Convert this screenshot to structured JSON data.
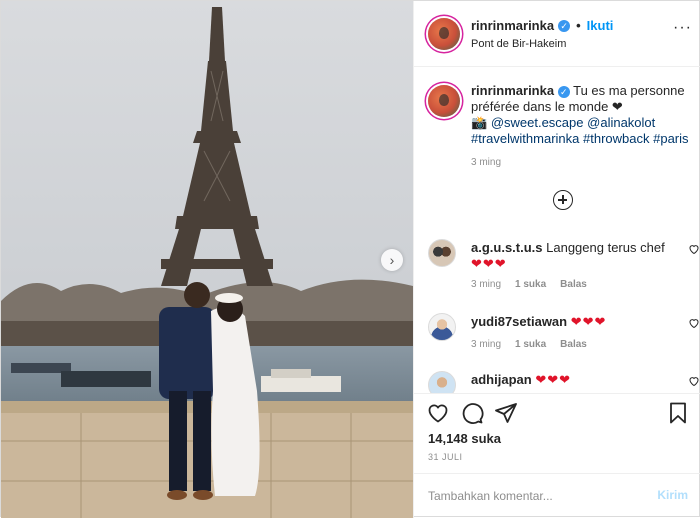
{
  "colors": {
    "accent": "#0095f6",
    "heart": "#e0142a",
    "border": "#dbdbdb",
    "muted": "#8e8e8e"
  },
  "post": {
    "username": "rinrinmarinka",
    "follow_label": "Ikuti",
    "location": "Pont de Bir-Hakeim",
    "caption": {
      "username": "rinrinmarinka",
      "text": "Tu es ma personne préférée dans le monde ❤",
      "camera_emoji": "📸",
      "mentions": [
        "@sweet.escape",
        "@alinakolot"
      ],
      "hashtags": [
        "#travelwithmarinka",
        "#throwback",
        "#paris"
      ],
      "time": "3 ming"
    },
    "comments": [
      {
        "username": "a.g.u.s.t.u.s",
        "text": "Langgeng terus chef",
        "hearts": "❤❤❤",
        "time": "3 ming",
        "likes": "1 suka",
        "reply": "Balas"
      },
      {
        "username": "yudi87setiawan",
        "text": "",
        "hearts": "❤❤❤",
        "time": "3 ming",
        "likes": "1 suka",
        "reply": "Balas"
      },
      {
        "username": "adhijapan",
        "text": "",
        "hearts": "❤❤❤"
      }
    ],
    "likes": "14,148 suka",
    "date": "31 JULI",
    "add_comment_placeholder": "Tambahkan komentar...",
    "post_button": "Kirim"
  }
}
